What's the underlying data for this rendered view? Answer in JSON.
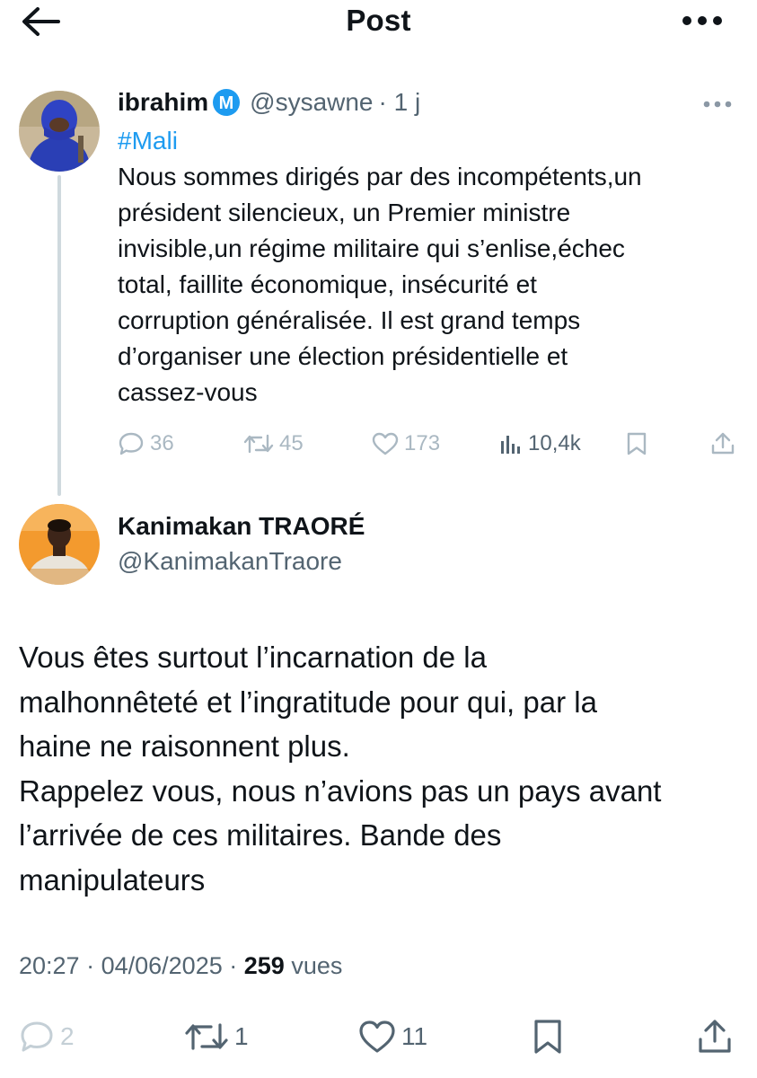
{
  "header": {
    "title": "Post",
    "back_icon": "arrow-left-icon",
    "more_icon": "more-horizontal-icon"
  },
  "parent_tweet": {
    "display_name": "ibrahim",
    "badge_letter": "M",
    "handle": "@sysawne",
    "time_ago": "· 1 j",
    "hashtag": "#Mali",
    "body_lines": [
      "Nous sommes dirigés par des incompétents,un",
      "président silencieux, un Premier ministre",
      "invisible,un régime militaire qui s’enlise,échec",
      "total, faillite économique, insécurité et",
      "corruption généralisée. Il est grand temps",
      "d’organiser une élection présidentielle et",
      "cassez-vous"
    ],
    "actions": {
      "replies": "36",
      "reposts": "45",
      "likes": "173",
      "views": "10,4k"
    }
  },
  "reply_tweet": {
    "display_name": "Kanimakan TRAORÉ",
    "handle": "@KanimakanTraore",
    "body_lines": [
      "Vous êtes surtout l’incarnation de la",
      "malhonnêteté et l’ingratitude pour qui, par la",
      "haine ne raisonnent plus.",
      "Rappelez vous, nous n’avions pas un pays avant",
      "l’arrivée de ces militaires. Bande des",
      "manipulateurs"
    ],
    "time": "20:27",
    "date": "04/06/2025",
    "views_count": "259",
    "views_label": "vues",
    "actions": {
      "replies": "2",
      "reposts": "1",
      "likes": "11"
    }
  },
  "colors": {
    "accent": "#1d9bf0",
    "text_primary": "#0f1419",
    "text_secondary": "#536471",
    "faded_icon": "#aab8c2",
    "thread_line": "#cfd9de"
  }
}
